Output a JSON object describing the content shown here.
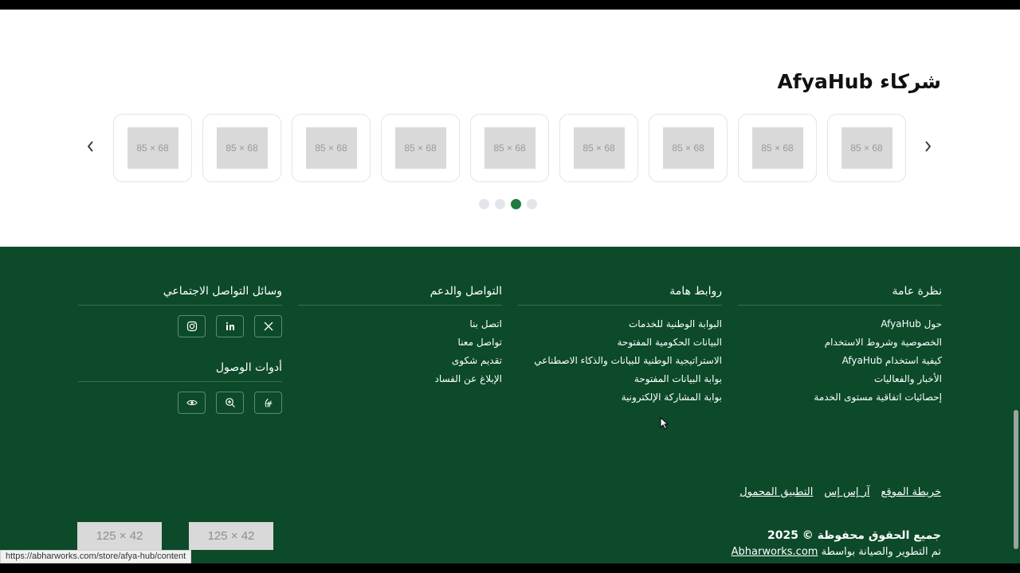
{
  "partners": {
    "title": "شركاء AfyaHub",
    "logo_placeholder": "85 × 68",
    "logo_count": 9,
    "prev_icon": "chevron-left-icon",
    "next_icon": "chevron-right-icon",
    "dots": 4,
    "active_dot": 2
  },
  "footer": {
    "overview": {
      "title": "نظرة عامة",
      "links": [
        "حول AfyaHub",
        "الخصوصية وشروط الاستخدام",
        "كيفية استخدام AfyaHub",
        "الأخبار والفعاليات",
        "إحصائيات اتفاقية مستوى الخدمة"
      ]
    },
    "important": {
      "title": "روابط هامة",
      "links": [
        "البوابة الوطنية للخدمات",
        "البيانات الحكومية المفتوحة",
        "الاستراتيجية الوطنية للبيانات والذكاء الاصطناعي",
        "بوابة البيانات المفتوحة",
        "بوابة المشاركة الإلكترونية"
      ]
    },
    "support": {
      "title": "التواصل والدعم",
      "links": [
        "اتصل بنا",
        "تواصل معنا",
        "تقديم شكوى",
        "الإبلاغ عن الفساد"
      ]
    },
    "social": {
      "title": "وسائل التواصل الاجتماعي",
      "icons": [
        "x-icon",
        "linkedin-icon",
        "instagram-icon"
      ]
    },
    "accessibility": {
      "title": "أدوات الوصول",
      "icons": [
        "sign-language-icon",
        "zoom-in-icon",
        "eye-icon"
      ]
    },
    "bottom_links": [
      "خريطة الموقع",
      "آر إس إس",
      "التطبيق المحمول"
    ],
    "copyright": "جميع الحقوق محفوظة © 2025",
    "credit_prefix": "تم التطوير والصيانة بواسطة",
    "credit_link": "Abharworks.com",
    "badge_placeholder": "125 × 42"
  },
  "status_url": "https://abharworks.com/store/afya-hub/content",
  "colors": {
    "footer_bg": "#0c4a2a",
    "accent": "#1f7a42"
  }
}
